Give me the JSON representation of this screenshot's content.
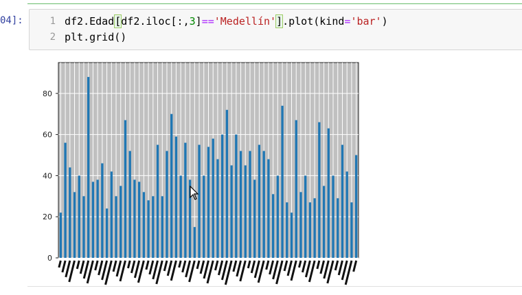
{
  "cell": {
    "prompt": "04]:",
    "lines": [
      {
        "num": "1",
        "parts": [
          {
            "t": "df2.Edad",
            "c": ""
          },
          {
            "t": "[",
            "c": "bracket-hl"
          },
          {
            "t": "df2.iloc[:,",
            "c": ""
          },
          {
            "t": "3",
            "c": "kw-num"
          },
          {
            "t": "]",
            "c": ""
          },
          {
            "t": "==",
            "c": "kw-op"
          },
          {
            "t": "'Medellín'",
            "c": "kw-str"
          },
          {
            "t": "]",
            "c": "bracket-hl"
          },
          {
            "t": ".plot(kind",
            "c": ""
          },
          {
            "t": "=",
            "c": "kw-op"
          },
          {
            "t": "'bar'",
            "c": "kw-str"
          },
          {
            "t": ")",
            "c": ""
          }
        ]
      },
      {
        "num": "2",
        "parts": [
          {
            "t": "plt.grid()",
            "c": ""
          }
        ]
      }
    ]
  },
  "chart_data": {
    "type": "bar",
    "yticks": [
      "0",
      "20",
      "40",
      "60",
      "80"
    ],
    "ylim": [
      0,
      95
    ],
    "grid": true,
    "color": "#1f77b4",
    "values": [
      22,
      56,
      44,
      32,
      40,
      30,
      88,
      37,
      38,
      46,
      24,
      42,
      30,
      35,
      67,
      52,
      38,
      37,
      32,
      28,
      30,
      55,
      30,
      52,
      70,
      59,
      40,
      56,
      38,
      15,
      55,
      40,
      54,
      58,
      48,
      60,
      72,
      45,
      60,
      52,
      45,
      52,
      38,
      55,
      52,
      48,
      31,
      40,
      74,
      27,
      22,
      67,
      32,
      40,
      27,
      29,
      66,
      35,
      63,
      40,
      29,
      55,
      42,
      27,
      50
    ]
  }
}
